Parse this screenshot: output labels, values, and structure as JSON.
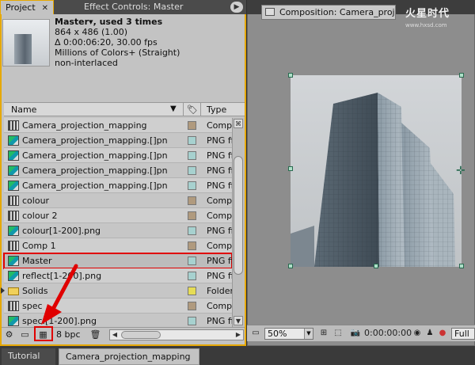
{
  "left_tabs": {
    "project": "Project",
    "effect_controls": "Effect Controls: Master"
  },
  "footage_info": {
    "title": "Master▾, used 3 times",
    "dimensions": "864 x 486 (1.00)",
    "duration": "Δ 0:00:06:20, 30.00 fps",
    "colors": "Millions of Colors+ (Straight)",
    "interlace": "non-interlaced"
  },
  "list_header": {
    "name": "Name",
    "type": "Type"
  },
  "rows": [
    {
      "name": "Camera_projection_mapping",
      "type": "Comp",
      "kind": "comp",
      "label_color": "#b09a7e"
    },
    {
      "name": "Camera_projection_mapping.[]pn",
      "type": "PNG file",
      "kind": "png",
      "label_color": "#a7d1cf"
    },
    {
      "name": "Camera_projection_mapping.[]pn",
      "type": "PNG file",
      "kind": "png",
      "label_color": "#a7d1cf"
    },
    {
      "name": "Camera_projection_mapping.[]pn",
      "type": "PNG file",
      "kind": "png",
      "label_color": "#a7d1cf"
    },
    {
      "name": "Camera_projection_mapping.[]pn",
      "type": "PNG file",
      "kind": "png",
      "label_color": "#a7d1cf"
    },
    {
      "name": "colour",
      "type": "Comp",
      "kind": "comp",
      "label_color": "#b09a7e"
    },
    {
      "name": "colour 2",
      "type": "Comp",
      "kind": "comp",
      "label_color": "#b09a7e"
    },
    {
      "name": "colour[1-200].png",
      "type": "PNG file",
      "kind": "png",
      "label_color": "#a7d1cf"
    },
    {
      "name": "Comp 1",
      "type": "Comp",
      "kind": "comp",
      "label_color": "#b09a7e"
    },
    {
      "name": "Master",
      "type": "PNG file",
      "kind": "png",
      "label_color": "#a7d1cf",
      "selected": true
    },
    {
      "name": "reflect[1-200].png",
      "type": "PNG file",
      "kind": "png",
      "label_color": "#a7d1cf"
    },
    {
      "name": "Solids",
      "type": "Folder",
      "kind": "folder",
      "label_color": "#e6dc55"
    },
    {
      "name": "spec",
      "type": "Comp",
      "kind": "comp",
      "label_color": "#b09a7e"
    },
    {
      "name": "spec.[1-200].png",
      "type": "PNG file",
      "kind": "png",
      "label_color": "#a7d1cf"
    }
  ],
  "bottom_toolbar": {
    "bpc": "8 bpc"
  },
  "composition": {
    "tab_label": "Composition: Camera_projection_mapping",
    "watermark": "火星时代",
    "watermark_url": "www.hxsd.com",
    "zoom": "50%",
    "timecode": "0:00:00:00",
    "resolution": "Full"
  },
  "bottom_tabs": {
    "tutorial": "Tutorial",
    "timeline": "Camera_projection_mapping"
  },
  "colors": {
    "active_panel_border": "#e6a800",
    "annotation_red": "#e00000"
  }
}
